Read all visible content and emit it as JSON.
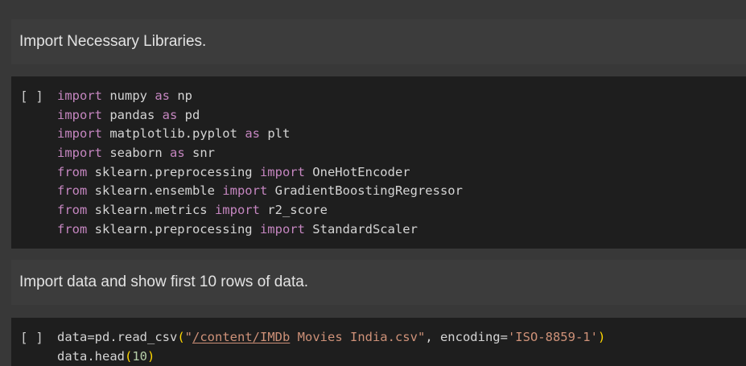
{
  "cells": [
    {
      "type": "text",
      "text": "Import Necessary Libraries."
    },
    {
      "type": "code",
      "run_label": "[ ]",
      "lines": [
        [
          {
            "k": "kw",
            "t": "import"
          },
          {
            "k": "id",
            "t": " numpy "
          },
          {
            "k": "kw",
            "t": "as"
          },
          {
            "k": "id",
            "t": " np"
          }
        ],
        [
          {
            "k": "kw",
            "t": "import"
          },
          {
            "k": "id",
            "t": " pandas "
          },
          {
            "k": "kw",
            "t": "as"
          },
          {
            "k": "id",
            "t": " pd"
          }
        ],
        [
          {
            "k": "kw",
            "t": "import"
          },
          {
            "k": "id",
            "t": " matplotlib.pyplot "
          },
          {
            "k": "kw",
            "t": "as"
          },
          {
            "k": "id",
            "t": " plt"
          }
        ],
        [
          {
            "k": "kw",
            "t": "import"
          },
          {
            "k": "id",
            "t": " seaborn "
          },
          {
            "k": "kw",
            "t": "as"
          },
          {
            "k": "id",
            "t": " snr"
          }
        ],
        [
          {
            "k": "kw",
            "t": "from"
          },
          {
            "k": "id",
            "t": " sklearn.preprocessing "
          },
          {
            "k": "kw",
            "t": "import"
          },
          {
            "k": "id",
            "t": " OneHotEncoder"
          }
        ],
        [
          {
            "k": "kw",
            "t": "from"
          },
          {
            "k": "id",
            "t": " sklearn.ensemble "
          },
          {
            "k": "kw",
            "t": "import"
          },
          {
            "k": "id",
            "t": " GradientBoostingRegressor"
          }
        ],
        [
          {
            "k": "kw",
            "t": "from"
          },
          {
            "k": "id",
            "t": " sklearn.metrics "
          },
          {
            "k": "kw",
            "t": "import"
          },
          {
            "k": "id",
            "t": " r2_score"
          }
        ],
        [
          {
            "k": "kw",
            "t": "from"
          },
          {
            "k": "id",
            "t": " sklearn.preprocessing "
          },
          {
            "k": "kw",
            "t": "import"
          },
          {
            "k": "id",
            "t": " StandardScaler"
          }
        ]
      ]
    },
    {
      "type": "text",
      "text": "Import data and show first 10 rows of data."
    },
    {
      "type": "code",
      "run_label": "[ ]",
      "lines": [
        [
          {
            "k": "id",
            "t": "data=pd.read_csv"
          },
          {
            "k": "paren",
            "t": "("
          },
          {
            "k": "str",
            "t": "\""
          },
          {
            "k": "str link",
            "t": "/content/IMDb"
          },
          {
            "k": "str",
            "t": " Movies India.csv\""
          },
          {
            "k": "id",
            "t": ", encoding="
          },
          {
            "k": "str",
            "t": "'ISO-8859-1'"
          },
          {
            "k": "paren",
            "t": ")"
          }
        ],
        [
          {
            "k": "id",
            "t": "data.head"
          },
          {
            "k": "paren",
            "t": "("
          },
          {
            "k": "num",
            "t": "10"
          },
          {
            "k": "paren",
            "t": ")"
          }
        ]
      ]
    }
  ],
  "colors": {
    "page_bg": "#383838",
    "text_cell_bg": "#3c3c3c",
    "code_cell_bg": "#1e1e1e",
    "keyword": "#c586c0",
    "string": "#ce9178",
    "number": "#b5cea8",
    "bracket": "#ffd700"
  }
}
